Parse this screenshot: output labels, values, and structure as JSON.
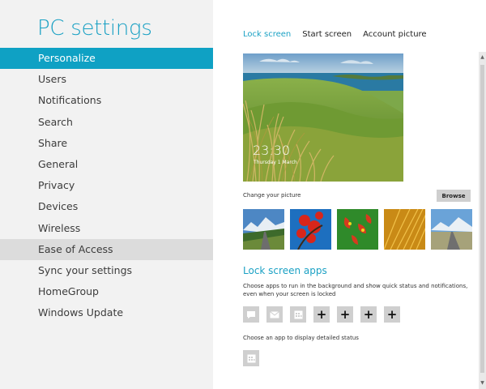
{
  "app": {
    "title": "PC settings"
  },
  "sidebar": {
    "items": [
      {
        "label": "Personalize",
        "state": "selected"
      },
      {
        "label": "Users",
        "state": ""
      },
      {
        "label": "Notifications",
        "state": ""
      },
      {
        "label": "Search",
        "state": ""
      },
      {
        "label": "Share",
        "state": ""
      },
      {
        "label": "General",
        "state": ""
      },
      {
        "label": "Privacy",
        "state": ""
      },
      {
        "label": "Devices",
        "state": ""
      },
      {
        "label": "Wireless",
        "state": ""
      },
      {
        "label": "Ease of Access",
        "state": "hover"
      },
      {
        "label": "Sync your settings",
        "state": ""
      },
      {
        "label": "HomeGroup",
        "state": ""
      },
      {
        "label": "Windows Update",
        "state": ""
      }
    ]
  },
  "tabs": [
    {
      "label": "Lock screen",
      "active": true
    },
    {
      "label": "Start screen",
      "active": false
    },
    {
      "label": "Account picture",
      "active": false
    }
  ],
  "lock_preview": {
    "time": "23:30",
    "date": "Thursday 1 March"
  },
  "picture": {
    "change_label": "Change your picture",
    "browse_label": "Browse",
    "thumbnails": [
      "mountain-road-thumbnail",
      "red-flower-thumbnail",
      "red-leaves-thumbnail",
      "golden-grass-thumbnail",
      "mountain-highway-thumbnail"
    ]
  },
  "lock_apps": {
    "heading": "Lock screen apps",
    "description": "Choose apps to run in the background and show quick status and notifications, even when your screen is locked",
    "slots": [
      "messaging-icon",
      "mail-icon",
      "calendar-icon",
      "plus-icon",
      "plus-icon",
      "plus-icon",
      "plus-icon"
    ],
    "detail_label": "Choose an app to display detailed status",
    "detail_slot": "calendar-icon"
  },
  "colors": {
    "accent": "#0fa1c4",
    "sidebar_bg": "#f2f2f2",
    "hover_bg": "#dcdcdc",
    "slot_bg": "#cfcfcf"
  }
}
